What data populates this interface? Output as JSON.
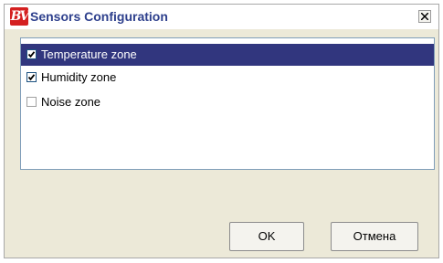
{
  "window": {
    "title": "Sensors Configuration",
    "app_icon_text": "BV",
    "close_glyph": "close-icon"
  },
  "list": {
    "items": [
      {
        "label": "Temperature zone",
        "checked": true,
        "selected": true
      },
      {
        "label": "Humidity zone",
        "checked": true,
        "selected": false
      },
      {
        "label": "Noise zone",
        "checked": false,
        "selected": false
      }
    ]
  },
  "buttons": {
    "ok_label": "OK",
    "cancel_label": "Отмена"
  },
  "colors": {
    "title_text": "#2d3f8c",
    "selection_bg": "#31367e",
    "app_icon": "#d42020"
  }
}
